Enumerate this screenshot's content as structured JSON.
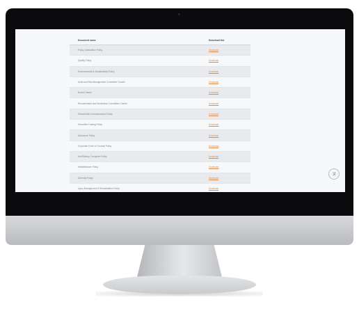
{
  "table": {
    "headers": {
      "name": "Document name",
      "link": "Download link"
    },
    "rows": [
      {
        "name": "Policy, Ambulation Policy",
        "link": "Download"
      },
      {
        "name": "Quality Policy",
        "link": "Download"
      },
      {
        "name": "Environmental & Sustainability Policy",
        "link": "Download"
      },
      {
        "name": "Audit and Risk Management Committee Charter",
        "link": "Download"
      },
      {
        "name": "Board Charter",
        "link": "Download"
      },
      {
        "name": "Remuneration and Nomination Committee Charter",
        "link": "Download"
      },
      {
        "name": "Shareholder Communication Policy",
        "link": "Download"
      },
      {
        "name": "Securities Trading Policy",
        "link": "Download"
      },
      {
        "name": "Disclosure Policy",
        "link": "Download"
      },
      {
        "name": "Corporate Code of Conduct Policy",
        "link": "Download"
      },
      {
        "name": "Anti-Bribery Corruption Policy",
        "link": "Download"
      },
      {
        "name": "Whistleblower Policy",
        "link": "Download"
      },
      {
        "name": "Diversity Policy",
        "link": "Download"
      },
      {
        "name": "Injury Management & Rehabilitation Policy",
        "link": "Download"
      }
    ]
  },
  "icons": {
    "scroll_top": "chevron-up-icon"
  }
}
